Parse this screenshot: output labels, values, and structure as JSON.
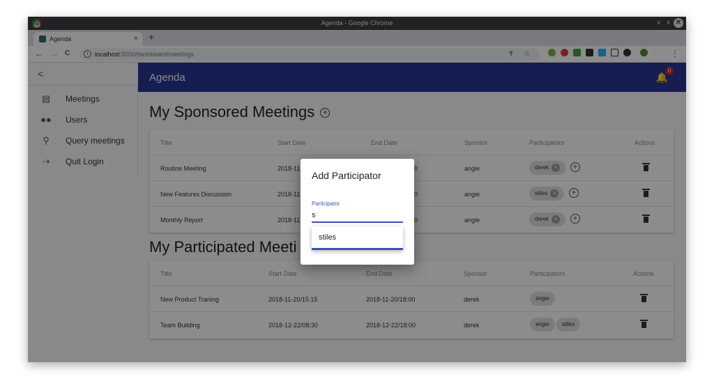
{
  "window": {
    "title": "Agenda - Google Chrome",
    "controls": [
      "∨",
      "∧"
    ],
    "close": "✕"
  },
  "tab": {
    "title": "Agenda",
    "close": "×",
    "new": "+"
  },
  "address": {
    "host": "localhost",
    "path": ":5000/dashboard/meetings",
    "nav": [
      "←",
      "→",
      "C"
    ],
    "info": "i",
    "icons": "☤ ☆"
  },
  "sidebar": {
    "back": "<",
    "items": [
      {
        "label": "Meetings",
        "icon": "clipboard-icon"
      },
      {
        "label": "Users",
        "icon": "people-icon"
      },
      {
        "label": "Query meetings",
        "icon": "search-icon"
      },
      {
        "label": "Quit Login",
        "icon": "exit-icon"
      }
    ]
  },
  "appbar": {
    "title": "Agenda",
    "badge": "0"
  },
  "sponsored": {
    "title": "My Sponsored Meetings",
    "headers": [
      "Title",
      "Start Date",
      "End Date",
      "Sponsor",
      "Participators",
      "Actions"
    ],
    "rows": [
      {
        "title": "Routine Meeting",
        "start": "2018-11-",
        "end": "0",
        "sponsor": "angie",
        "chips": [
          "derek"
        ]
      },
      {
        "title": "New Features Discussion",
        "start": "2018-11-",
        "end": "0",
        "sponsor": "angie",
        "chips": [
          "stiles"
        ]
      },
      {
        "title": "Monthly Report",
        "start": "2018-11-",
        "end": "0",
        "sponsor": "angie",
        "chips": [
          "derek"
        ]
      }
    ]
  },
  "participated": {
    "title": "My Participated Meeti",
    "headers": [
      "Title",
      "Start Date",
      "End Date",
      "Sponsor",
      "Participators",
      "Actions"
    ],
    "rows": [
      {
        "title": "New Product Traning",
        "start": "2018-11-20/15:15",
        "end": "2018-11-20/18:00",
        "sponsor": "derek",
        "chips": [
          "angie"
        ]
      },
      {
        "title": "Team Building",
        "start": "2018-12-22/08:30",
        "end": "2018-12-22/18:00",
        "sponsor": "derek",
        "chips": [
          "angie",
          "stiles"
        ]
      }
    ]
  },
  "dialog": {
    "title": "Add Participator",
    "field_label": "Participator",
    "field_value": "s",
    "suggestion": "stiles"
  },
  "colors": {
    "appbar": "#283593",
    "accent": "#3f51b5",
    "badge": "#c62828"
  }
}
